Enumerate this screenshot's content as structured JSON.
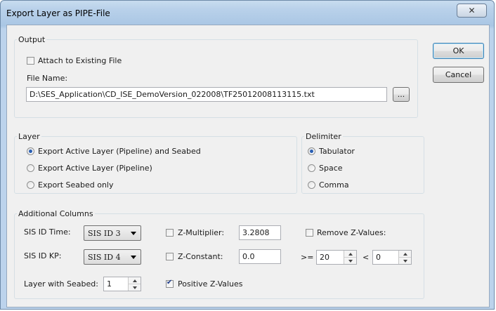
{
  "window": {
    "title": "Export Layer as PIPE-File",
    "close_glyph": "✕"
  },
  "buttons": {
    "ok": "OK",
    "cancel": "Cancel",
    "browse": "..."
  },
  "output": {
    "label": "Output",
    "attach_label": "Attach to Existing File",
    "attach_checked": false,
    "file_name_label": "File Name:",
    "file_name_value": "D:\\SES_Application\\CD_ISE_DemoVersion_022008\\TF25012008113115.txt"
  },
  "layer": {
    "label": "Layer",
    "options": [
      {
        "label": "Export Active Layer (Pipeline) and Seabed",
        "selected": true
      },
      {
        "label": "Export Active Layer (Pipeline)",
        "selected": false
      },
      {
        "label": "Export Seabed only",
        "selected": false
      }
    ]
  },
  "delimiter": {
    "label": "Delimiter",
    "options": [
      {
        "label": "Tabulator",
        "selected": true
      },
      {
        "label": "Space",
        "selected": false
      },
      {
        "label": "Comma",
        "selected": false
      }
    ]
  },
  "additional": {
    "label": "Additional Columns",
    "sis_id_time_label": "SIS ID Time:",
    "sis_id_time_value": "SIS ID 3",
    "sis_id_kp_label": "SIS ID KP:",
    "sis_id_kp_value": "SIS ID 4",
    "layer_seabed_label": "Layer with Seabed:",
    "layer_seabed_value": "1",
    "z_multiplier_label": "Z-Multiplier:",
    "z_multiplier_value": "3.2808",
    "z_multiplier_checked": false,
    "z_constant_label": "Z-Constant:",
    "z_constant_value": "0.0",
    "z_constant_checked": false,
    "positive_z_label": "Positive Z-Values",
    "positive_z_checked": true,
    "remove_z_label": "Remove Z-Values:",
    "remove_z_checked": false,
    "ge_label": ">=",
    "ge_value": "20",
    "lt_label": "<",
    "lt_value": "0"
  }
}
